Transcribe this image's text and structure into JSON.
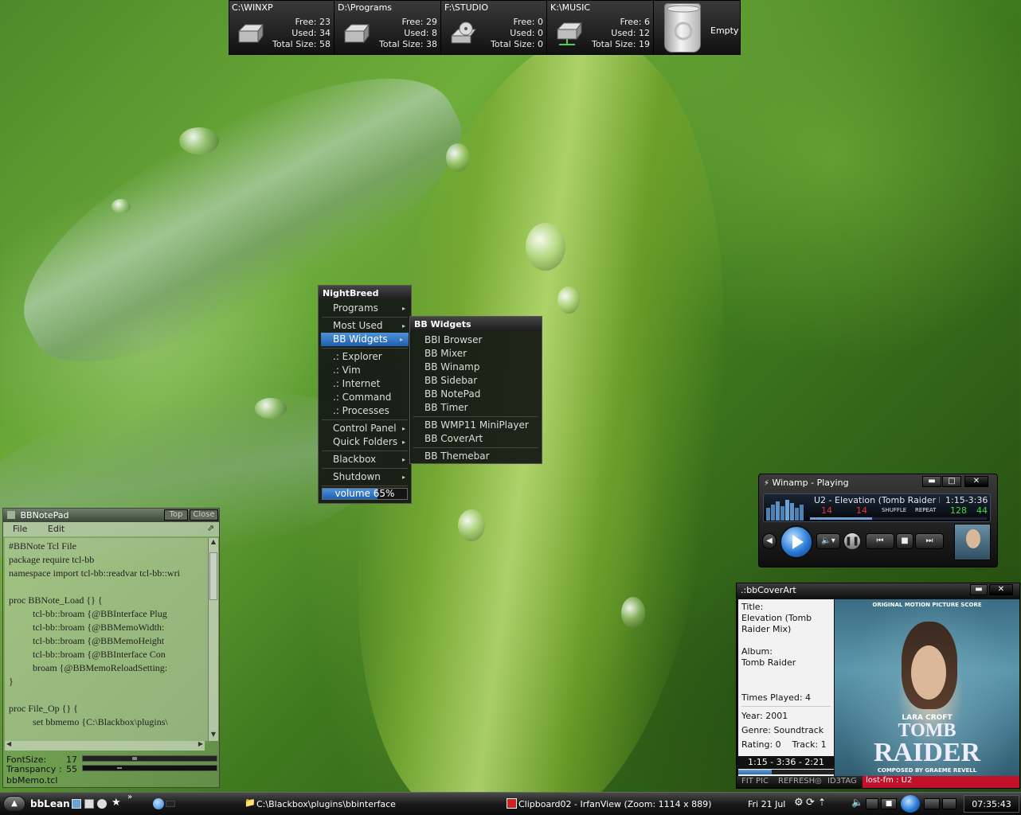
{
  "drives": [
    {
      "title": "C:\\WINXP",
      "free": "Free: 23",
      "used": "Used: 34",
      "total": "Total Size: 58",
      "type": "hdd"
    },
    {
      "title": "D:\\Programs",
      "free": "Free: 29",
      "used": "Used: 8",
      "total": "Total Size: 38",
      "type": "hdd"
    },
    {
      "title": "F:\\STUDIO",
      "free": "Free: 0",
      "used": "Used: 0",
      "total": "Total Size: 0",
      "type": "cd"
    },
    {
      "title": "K:\\MUSIC",
      "free": "Free: 6",
      "used": "Used: 12",
      "total": "Total Size: 19",
      "type": "net"
    }
  ],
  "recycle": {
    "label": "Empty"
  },
  "menu": {
    "title": "NightBreed",
    "items": [
      {
        "label": "Programs",
        "submenu": true
      },
      {
        "label": "Most Used",
        "submenu": true
      },
      {
        "label": "BB Widgets",
        "submenu": true,
        "selected": true
      },
      {
        "label": ".:  Explorer"
      },
      {
        "label": ".:  Vim"
      },
      {
        "label": ".:  Internet"
      },
      {
        "label": ".:  Command"
      },
      {
        "label": ".:  Processes"
      },
      {
        "label": "Control Panel",
        "submenu": true
      },
      {
        "label": "Quick Folders",
        "submenu": true
      },
      {
        "label": "Blackbox",
        "submenu": true
      },
      {
        "label": "Shutdown",
        "submenu": true
      }
    ],
    "volume": {
      "label": "volume 65%",
      "level": 0.65
    }
  },
  "submenu": {
    "title": "BB Widgets",
    "items": [
      "BBI Browser",
      "BB Mixer",
      "BB Winamp",
      "BB Sidebar",
      "BB NotePad",
      "BB Timer",
      "BB WMP11 MiniPlayer",
      "BB CoverArt",
      "BB Themebar"
    ]
  },
  "notepad": {
    "title": "BBNotePad",
    "top_btn": "Top",
    "close_btn": "Close",
    "menu_file": "File",
    "menu_edit": "Edit",
    "content": "#BBNote Tcl File\npackage require tcl-bb\nnamespace import tcl-bb::readvar tcl-bb::wri\n\nproc BBNote_Load {} {\n          tcl-bb::broam {@BBInterface Plug\n          tcl-bb::broam {@BBMemoWidth:\n          tcl-bb::broam {@BBMemoHeight\n          tcl-bb::broam {@BBInterface Con\n          broam {@BBMemoReloadSetting:\n}\n\nproc File_Op {} {\n          set bbmemo {C:\\Blackbox\\plugins\\",
    "fontsize_label": "FontSize:",
    "fontsize_value": "17",
    "transparency_label": "Transpancy :",
    "transparency_value": "55",
    "footer": "bbMemo.tcl"
  },
  "winamp": {
    "title": "Winamp - Playing",
    "track": "U2 - Elevation (Tomb Raider Mi",
    "time": "1:15-3:36",
    "val1": "14",
    "val2": "14",
    "shuffle": "SHUFFLE",
    "repeat": "REPEAT",
    "kbps": "128",
    "khz": "44",
    "progress": 0.35
  },
  "coverart": {
    "title": ".:bbCoverArt",
    "title_label": "Title:",
    "title_value": "Elevation (Tomb Raider Mix)",
    "album_label": "Album:",
    "album_value": "Tomb Raider",
    "times_played": "Times Played: 4",
    "year": "Year: 2001",
    "genre": "Genre: Soundtrack",
    "rating": "Rating: 0",
    "track": "Track: 1",
    "time": "1:15 - 3:36 - 2:21",
    "progress": 0.35,
    "btn_fit": "FIT PIC",
    "btn_refresh": "REFRESH",
    "btn_id3": "ID3TAG",
    "lastfm": "lost-fm : U2",
    "cover_top": "ORIGINAL MOTION PICTURE SCORE",
    "cover_name": "LARA CROFT",
    "cover_title1": "TOMB",
    "cover_title2": "RAIDER",
    "cover_bottom": "COMPOSED BY GRAEME REVELL"
  },
  "taskbar": {
    "start": "bbLean",
    "task1": "C:\\Blackbox\\plugins\\bbinterface",
    "task2": "Clipboard02 - IrfanView (Zoom: 1114 x 889)",
    "date": "Fri 21 Jul",
    "clock": "07:35:43"
  }
}
